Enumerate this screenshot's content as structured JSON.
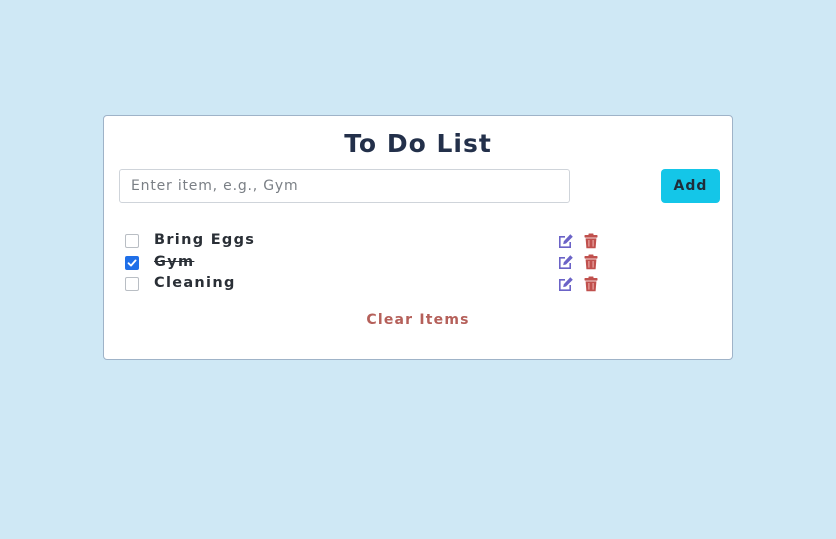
{
  "header": {
    "title": "To Do List"
  },
  "form": {
    "input_placeholder": "Enter item, e.g., Gym",
    "input_value": "",
    "add_label": "Add"
  },
  "items": [
    {
      "label": "Bring Eggs",
      "checked": false
    },
    {
      "label": "Gym",
      "checked": true
    },
    {
      "label": "Cleaning",
      "checked": false
    }
  ],
  "clear_label": "Clear Items",
  "icons": {
    "edit": "edit-icon",
    "delete": "trash-icon"
  },
  "colors": {
    "background": "#cfe8f5",
    "accent": "#14c6e8",
    "edit": "#6b63c7",
    "delete": "#c0504d",
    "clear": "#b5605a",
    "checkbox": "#1f6fe8"
  }
}
